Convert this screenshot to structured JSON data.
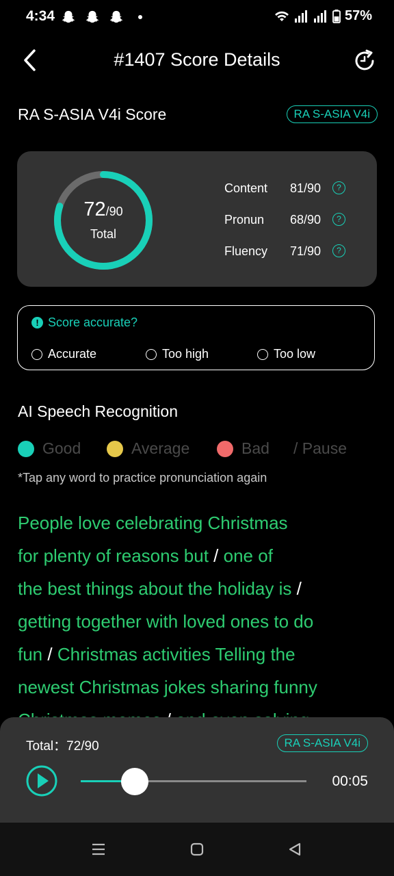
{
  "status": {
    "time": "4:34",
    "battery": "57%"
  },
  "header": {
    "title": "#1407 Score Details"
  },
  "score_section": {
    "title": "RA S-ASIA V4i Score",
    "tag": "RA S-ASIA V4i"
  },
  "score_card": {
    "total_value": "72",
    "total_max": "/90",
    "total_label": "Total",
    "total_fraction": 0.8,
    "metrics": [
      {
        "name": "Content",
        "value": "81/90",
        "help": "?"
      },
      {
        "name": "Pronun",
        "value": "68/90",
        "help": "?"
      },
      {
        "name": "Fluency",
        "value": "71/90",
        "help": "?"
      }
    ]
  },
  "accuracy": {
    "question": "Score accurate?",
    "info": "!",
    "options": [
      "Accurate",
      "Too high",
      "Too low"
    ]
  },
  "recognition": {
    "title": "AI Speech Recognition",
    "legend": {
      "good": "Good",
      "average": "Average",
      "bad": "Bad",
      "pause": "/ Pause",
      "colors": {
        "good": "#19d0b8",
        "average": "#e6c84a",
        "bad": "#f06a6a"
      }
    },
    "hint": "*Tap any word to practice pronunciation again",
    "lines": [
      [
        "People love celebrating Christmas"
      ],
      [
        "for plenty of reasons but",
        " / ",
        "one of"
      ],
      [
        "the best things about the holiday is",
        " /"
      ],
      [
        "getting together with loved ones to do"
      ],
      [
        "fun",
        " / ",
        "Christmas activities Telling the"
      ],
      [
        "newest Christmas jokes sharing funny"
      ],
      [
        "Christmas memes",
        " / ",
        "and even solving"
      ]
    ]
  },
  "player": {
    "total_label": "Total：",
    "total_value": "72/90",
    "tag": "RA S-ASIA V4i",
    "time": "00:05",
    "progress": 0.24
  },
  "colors": {
    "accent": "#19d0b8",
    "good_text": "#2ecc71",
    "card": "#333333"
  }
}
